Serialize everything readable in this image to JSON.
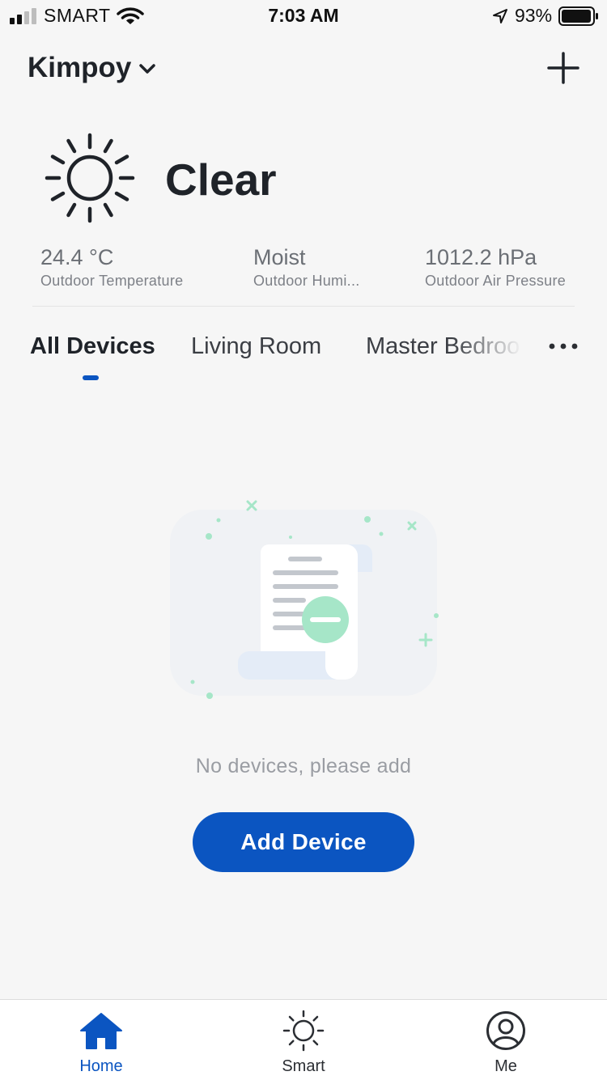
{
  "status_bar": {
    "carrier": "SMART",
    "time": "7:03 AM",
    "battery_percent": "93%",
    "icons": [
      "signal-icon",
      "wifi-icon",
      "location-arrow-icon",
      "battery-icon"
    ]
  },
  "header": {
    "home_name": "Kimpoy",
    "home_selector_icon": "chevron-down-icon",
    "add_icon": "plus-icon"
  },
  "weather": {
    "icon": "sun-icon",
    "condition": "Clear",
    "stats": [
      {
        "value": "24.4 °C",
        "label": "Outdoor Temperature"
      },
      {
        "value": "Moist",
        "label": "Outdoor Humi..."
      },
      {
        "value": "1012.2 hPa",
        "label": "Outdoor Air Pressure"
      }
    ]
  },
  "tabs": {
    "items": [
      {
        "label": "All Devices",
        "active": true
      },
      {
        "label": "Living Room",
        "active": false
      },
      {
        "label": "Master Bedroo",
        "active": false
      }
    ],
    "more_icon": "more-dots-icon"
  },
  "empty_state": {
    "illustration": "empty-document-illustration",
    "message": "No devices, please add",
    "button_label": "Add Device"
  },
  "bottom_nav": {
    "items": [
      {
        "label": "Home",
        "icon": "home-icon",
        "active": true
      },
      {
        "label": "Smart",
        "icon": "sun-icon",
        "active": false
      },
      {
        "label": "Me",
        "icon": "user-icon",
        "active": false
      }
    ]
  },
  "colors": {
    "accent": "#0b55c1",
    "background": "#f6f6f6",
    "illustration_green": "#a6e6c8"
  }
}
